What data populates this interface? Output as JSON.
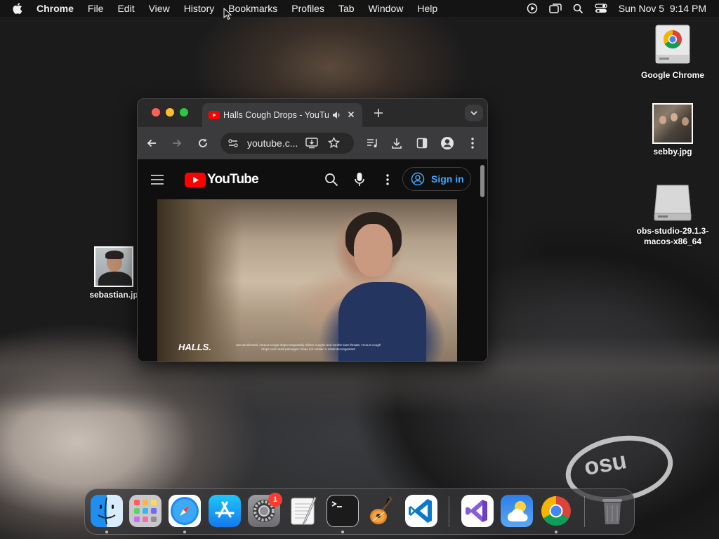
{
  "menubar": {
    "app_name": "Chrome",
    "items": [
      "File",
      "Edit",
      "View",
      "History",
      "Bookmarks",
      "Profiles",
      "Tab",
      "Window",
      "Help"
    ],
    "datetime": "Sun Nov 5  9:14 PM"
  },
  "desktop": {
    "icons": [
      {
        "label": "Google Chrome"
      },
      {
        "label": "sebby.jpg"
      },
      {
        "label": "obs-studio-29.1.3-macos-x86_64"
      },
      {
        "label": "sebastian.jp"
      }
    ]
  },
  "browser": {
    "tab_title": "Halls Cough Drops - YouTube",
    "url": "youtube.c...",
    "youtube": {
      "logo_text": "YouTube",
      "sign_in": "Sign in"
    },
    "video": {
      "brand_text": "HALLS.",
      "caption": "Use as directed. HALLS cough drops temporarily relieve coughs and soothe sore throats. HALLS cough drops cool nasal passages. Does not contain a nasal decongestant"
    }
  },
  "dock": {
    "apps": [
      "finder",
      "launchpad",
      "safari",
      "app-store",
      "system-settings",
      "textedit",
      "terminal",
      "garageband",
      "vscode",
      "visual-studio",
      "weather",
      "chrome",
      "trash"
    ],
    "system_settings_badge": "1"
  },
  "colors": {
    "youtube_red": "#ff0000",
    "signin_blue": "#3ea6ff",
    "close_red": "#ff5f57",
    "minimize_yellow": "#febc2e",
    "zoom_green": "#28c840"
  }
}
